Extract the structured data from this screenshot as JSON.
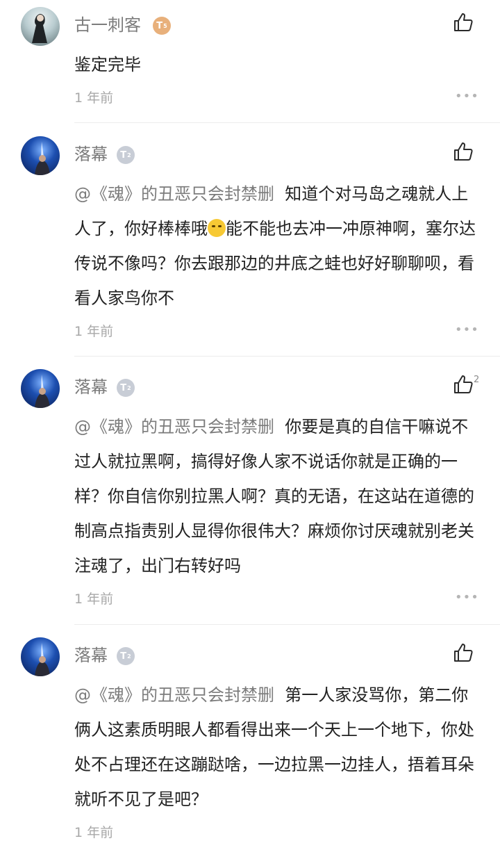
{
  "comments": [
    {
      "username": "古一刺客",
      "level": "T",
      "level_sub": "5",
      "mention": "",
      "text_before_emoji": "鉴定完毕",
      "text_after_emoji": "",
      "time": "1 年前",
      "likes": ""
    },
    {
      "username": "落幕",
      "level": "T",
      "level_sub": "2",
      "mention": "@《魂》的丑恶只会封禁删",
      "text_before_emoji": "  知道个对马岛之魂就人上人了，你好棒棒哦",
      "text_after_emoji": "能不能也去冲一冲原神啊，塞尔达传说不像吗？你去跟那边的井底之蛙也好好聊聊呗，看看人家鸟你不",
      "time": "1 年前",
      "likes": ""
    },
    {
      "username": "落幕",
      "level": "T",
      "level_sub": "2",
      "mention": "@《魂》的丑恶只会封禁删",
      "text_before_emoji": "  你要是真的自信干嘛说不过人就拉黑啊，搞得好像人家不说话你就是正确的一样？你自信你别拉黑人啊？真的无语，在这站在道德的制高点指责别人显得你很伟大？麻烦你讨厌魂就别老关注魂了，出门右转好吗",
      "text_after_emoji": "",
      "time": "1 年前",
      "likes": "2"
    },
    {
      "username": "落幕",
      "level": "T",
      "level_sub": "2",
      "mention": "@《魂》的丑恶只会封禁删",
      "text_before_emoji": "  第一人家没骂你，第二你俩人这素质明眼人都看得出来一个天上一个地下，你处处不占理还在这蹦跶啥，一边拉黑一边挂人，捂着耳朵就听不见了是吧？",
      "text_after_emoji": "",
      "time": "1 年前",
      "likes": ""
    }
  ],
  "icons": {
    "like": "thumbs-up-icon",
    "more": "more-dots-icon",
    "emoji": "eye-roll-emoji-icon"
  },
  "more_label": "•••",
  "colors": {
    "username": "#7c7c7c",
    "text": "#222222",
    "mention": "#7b7b7b",
    "time": "#a8a8a8",
    "level_gold": "#e8b07b",
    "level_silver": "#c8cdd6"
  }
}
